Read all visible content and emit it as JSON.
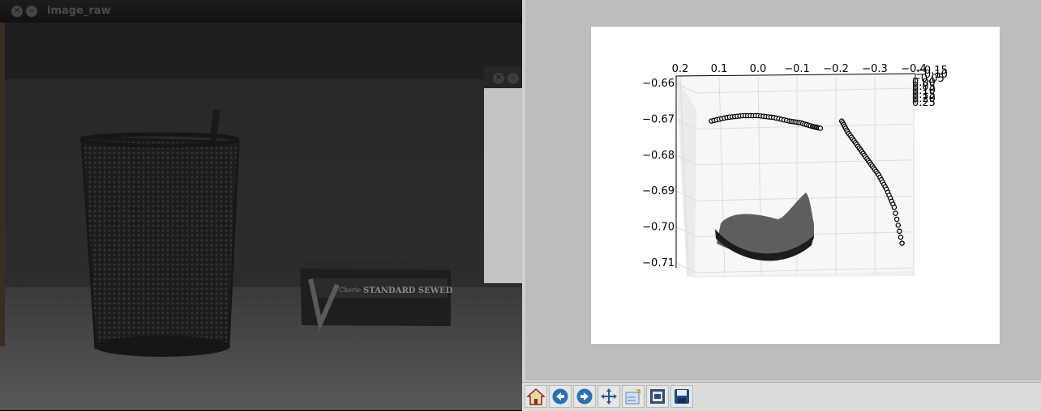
{
  "camera_window": {
    "title": "image_raw",
    "box_label": "STANDARD SEWED",
    "box_brand": "Cherie"
  },
  "plot_window": {
    "toolbar": {
      "home_icon": "home-icon",
      "back_icon": "arrow-left-icon",
      "forward_icon": "arrow-right-icon",
      "pan_icon": "move-arrows-icon",
      "subplots_icon": "configure-subplots-icon",
      "edit_icon": "edit-axes-icon",
      "save_icon": "floppy-save-icon"
    }
  },
  "chart_data": {
    "type": "scatter",
    "projection": "3d",
    "x_ticks": [
      "0.2",
      "0.1",
      "0.0",
      "−0.1",
      "−0.2",
      "−0.3",
      "−0.4"
    ],
    "y_ticks": [
      "−0.66",
      "−0.67",
      "−0.68",
      "−0.69",
      "−0.70",
      "−0.71"
    ],
    "z_ticks": [
      "−0.15",
      "−0.10",
      "−0.05",
      "0.00",
      "0.05",
      "0.10",
      "0.15",
      "0.20",
      "0.25"
    ],
    "xlim": [
      0.2,
      -0.4
    ],
    "ylim": [
      -0.71,
      -0.66
    ],
    "grid": true,
    "series": [
      {
        "marker": "o",
        "color": "#000000",
        "x": [
          -0.215,
          -0.23,
          -0.25,
          -0.27,
          -0.29,
          -0.31,
          -0.33,
          -0.35,
          -0.37
        ],
        "y": [
          -0.6995,
          -0.6965,
          -0.6935,
          -0.6905,
          -0.6875,
          -0.6845,
          -0.6805,
          -0.6755,
          -0.6655
        ]
      },
      {
        "marker": "o",
        "color": "#000000",
        "x": [
          0.12,
          0.08,
          0.04,
          0.0,
          -0.04,
          -0.08,
          -0.11,
          -0.14,
          -0.16
        ],
        "y": [
          -0.6995,
          -0.7005,
          -0.701,
          -0.701,
          -0.7005,
          -0.6995,
          -0.699,
          -0.698,
          -0.6975
        ]
      }
    ]
  }
}
